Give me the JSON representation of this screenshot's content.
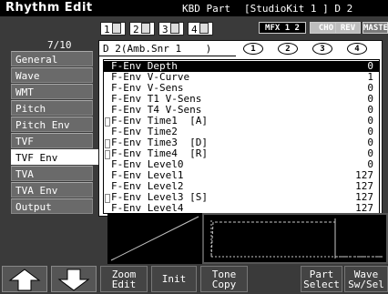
{
  "header": {
    "title": "Rhythm Edit",
    "kbd_part": "KBD Part",
    "kit_name": "[StudioKit 1 ] D 2"
  },
  "parts": [
    "1",
    "2",
    "3",
    "4"
  ],
  "effects": {
    "mfx": "MFX 1 2",
    "chorus": "CHO",
    "reverb": "REV",
    "master": "MASTER"
  },
  "page_indicator": "7/10",
  "tabs": [
    {
      "label": "General"
    },
    {
      "label": "Wave"
    },
    {
      "label": "WMT"
    },
    {
      "label": "Pitch"
    },
    {
      "label": "Pitch Env"
    },
    {
      "label": "TVF"
    },
    {
      "label": "TVF Env"
    },
    {
      "label": "TVA"
    },
    {
      "label": "TVA Env"
    },
    {
      "label": "Output"
    }
  ],
  "active_tab": "TVF Env",
  "tone_select": "D 2(Amb.Snr 1    )",
  "wave_circles": [
    "1",
    "2",
    "3",
    "4"
  ],
  "params": [
    {
      "label": "F-Env Depth",
      "value": "0"
    },
    {
      "label": "F-Env V-Curve",
      "value": "1"
    },
    {
      "label": "F-Env V-Sens",
      "value": "0"
    },
    {
      "label": "F-Env T1 V-Sens",
      "value": "0"
    },
    {
      "label": "F-Env T4 V-Sens",
      "value": "0"
    },
    {
      "label": "F-Env Time1  [A]",
      "value": "0"
    },
    {
      "label": "F-Env Time2",
      "value": "0"
    },
    {
      "label": "F-Env Time3  [D]",
      "value": "0"
    },
    {
      "label": "F-Env Time4  [R]",
      "value": "0"
    },
    {
      "label": "F-Env Level0",
      "value": "0"
    },
    {
      "label": "F-Env Level1",
      "value": "127"
    },
    {
      "label": "F-Env Level2",
      "value": "127"
    },
    {
      "label": "F-Env Level3 [S]",
      "value": "127"
    },
    {
      "label": "F-Env Level4",
      "value": "127"
    }
  ],
  "buttons": {
    "zoom_edit": "Zoom\nEdit",
    "init": "Init",
    "tone_copy": "Tone\nCopy",
    "part_select": "Part\nSelect",
    "wave_sw_sel": "Wave\nSw/Sel"
  },
  "colors": {
    "background": "#3a3a3a",
    "title_bar": "#000000",
    "list_bg": "#ffffff",
    "tab_bg": "#6a6a6a",
    "graph_line": "#c8c8c8"
  }
}
